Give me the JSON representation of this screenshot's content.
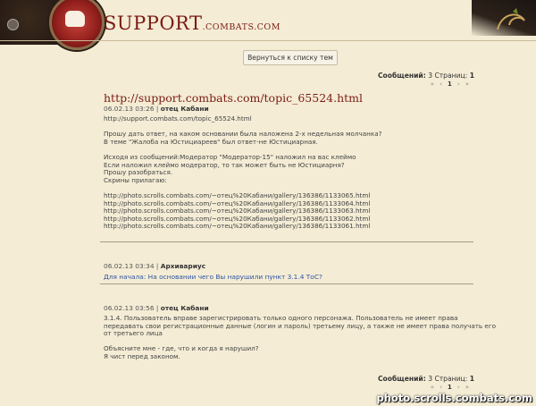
{
  "header": {
    "brand_main": "SUPPORT",
    "brand_domain": ".COMBATS.COM"
  },
  "nav": {
    "back_button": "Вернуться к списку тем"
  },
  "meta": {
    "messages_label": "Сообщений:",
    "messages_count": "3",
    "pages_label": "Страниц:",
    "pages_count": "1",
    "pager": {
      "first": "«",
      "prev": "‹",
      "current": "1",
      "next": "›",
      "last": "»"
    }
  },
  "topic": {
    "title": "http://support.combats.com/topic_65524.html"
  },
  "posts": [
    {
      "date": "06.02.13 03:26",
      "separator": "|",
      "author": "отец Кабани",
      "body": "http://support.combats.com/topic_65524.html\n\nПрошу дать ответ, на каком основании была наложена 2-х недельная молчанка?\nВ теме \"Жалоба на Юстициареев\" был ответ-не Юстициарная.\n\nИсходя из сообщений:Модератор \"Модератор-15\" наложил на вас клеймо\nЕсли наложил клеймо модератор, то так может быть не Юстициарня?\nПрошу разобраться.\nСкрины прилагаю:\n\nhttp://photo.scrolls.combats.com/~отец%20Кабани/gallery/136386/1133065.html\nhttp://photo.scrolls.combats.com/~отец%20Кабани/gallery/136386/1133064.html\nhttp://photo.scrolls.combats.com/~отец%20Кабани/gallery/136386/1133063.html\nhttp://photo.scrolls.combats.com/~отец%20Кабани/gallery/136386/1133062.html\nhttp://photo.scrolls.combats.com/~отец%20Кабани/gallery/136386/1133061.html"
    },
    {
      "date": "06.02.13 03:34",
      "separator": "|",
      "author": "Архивариус",
      "body": "Для начала: На основании чего Вы нарушили пункт 3.1.4 ТоС?"
    },
    {
      "date": "06.02.13 03:56",
      "separator": "|",
      "author": "отец Кабани",
      "body": "3.1.4. Пользователь вправе зарегистрировать только одного персонажа. Пользователь не имеет права\nпередавать свои регистрационные данные (логин и пароль) третьему лицу, а также не имеет права получать его\nот третьего лица\n\nОбъясните мне - где, что и когда я нарушил?\nЯ чист перед законом."
    }
  ],
  "watermark": "photo.scrolls.combats.com"
}
